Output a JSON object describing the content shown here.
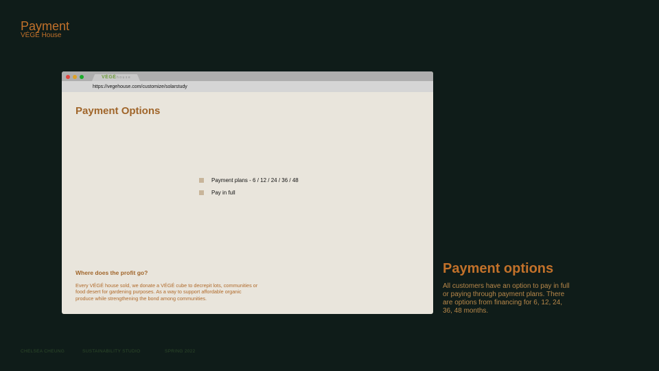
{
  "slide": {
    "title": "Payment",
    "subtitle": "VÉGÉ House"
  },
  "browser": {
    "tab": {
      "logo_text": "VÉGÉ",
      "house_text": "house"
    },
    "url": "https://vegehouse.com/customize/solarstudy",
    "window_controls": {
      "close_color": "#e0443e",
      "minimize_color": "#dea123",
      "maximize_color": "#1aab29"
    }
  },
  "content": {
    "heading": "Payment Options",
    "options": [
      {
        "label": "Payment plans - 6 / 12 / 24 / 36 / 48"
      },
      {
        "label": "Pay in full"
      }
    ],
    "profit": {
      "heading": "Where does the profit go?",
      "text": "Every VÉGÉ house sold, we donate a VÉGÉ  cube to decrepit lots, communities or food desert for gardening purposes. As a way to support affordable organic produce while strengthening the bond among communities."
    }
  },
  "side": {
    "heading": "Payment options",
    "text": "All customers have an option to pay in full or paying through payment plans. There are options from financing for 6, 12, 24, 36, 48 months."
  },
  "footer": {
    "author": "CHELSEA CHEUNG",
    "studio": "SUSTAINABILITY STUDIO",
    "term": "SPRING 2022"
  },
  "colors": {
    "background": "#0f1c19",
    "accent": "#c2712a",
    "browser_page": "#e9e5dc",
    "option_box": "#c8b59a"
  }
}
